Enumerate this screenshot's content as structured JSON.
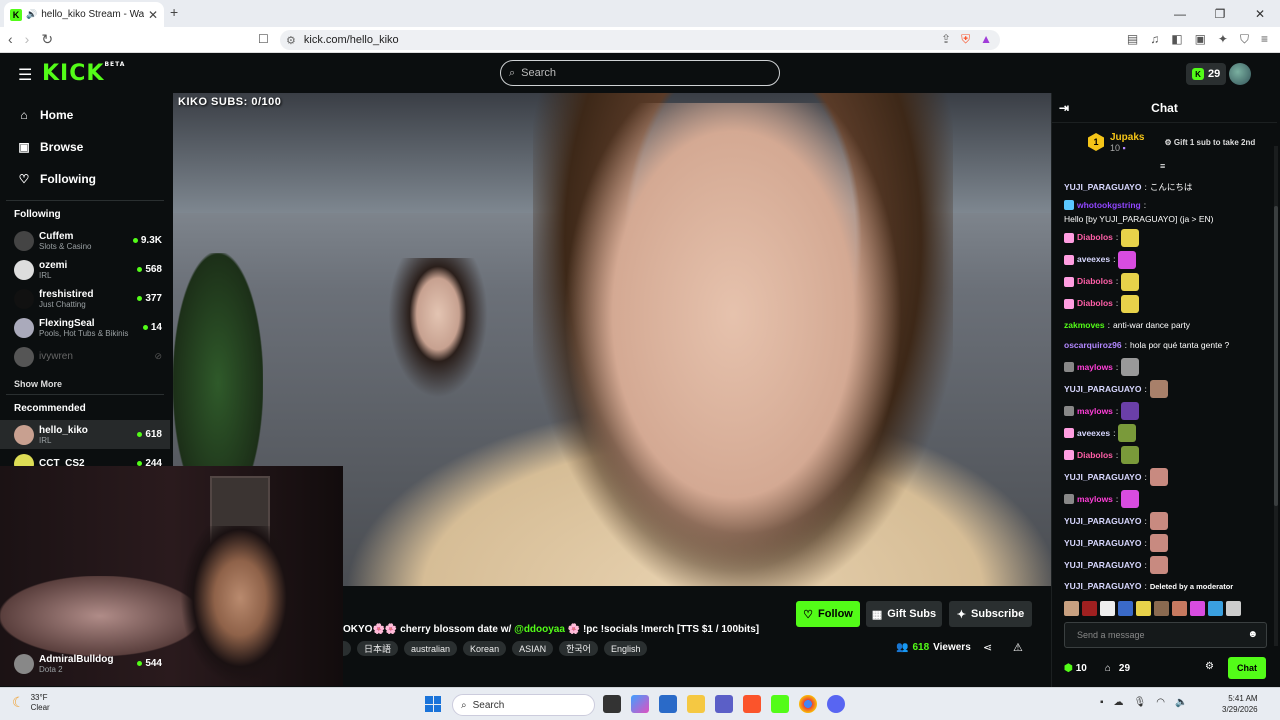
{
  "browser": {
    "tab_title": "hello_kiko Stream - Watch Li",
    "url": "kick.com/hello_kiko"
  },
  "topnav": {
    "logo": "KICK",
    "logo_badge": "BETA",
    "search_placeholder": "Search",
    "points": "29"
  },
  "sidebar": {
    "nav": [
      {
        "label": "Home"
      },
      {
        "label": "Browse"
      },
      {
        "label": "Following"
      }
    ],
    "following_label": "Following",
    "following": [
      {
        "name": "Cuffem",
        "category": "Slots & Casino",
        "viewers": "9.3K"
      },
      {
        "name": "ozemi",
        "category": "IRL",
        "viewers": "568"
      },
      {
        "name": "freshistired",
        "category": "Just Chatting",
        "viewers": "377"
      },
      {
        "name": "FlexingSeal",
        "category": "Pools, Hot Tubs & Bikinis",
        "viewers": "14"
      },
      {
        "name": "ivywren",
        "category": "",
        "viewers": ""
      }
    ],
    "show_more": "Show More",
    "recommended_label": "Recommended",
    "recommended": [
      {
        "name": "hello_kiko",
        "category": "IRL",
        "viewers": "618"
      },
      {
        "name": "CCT_CS2",
        "category": "",
        "viewers": "244"
      }
    ],
    "bottom_channel": {
      "name": "AdmiralBulldog",
      "category": "Dota 2",
      "viewers": "544"
    }
  },
  "video": {
    "overlay_text": "KIKO SUBS: 0/100"
  },
  "stream": {
    "title_prefix": "OKYO🌸🌸 cherry blossom date w/ ",
    "title_mention": "@ddooyaa",
    "title_suffix": " 🌸 !pc !socials !merch [TTS $1 / 100bits]",
    "tags": [
      "日本語",
      "australian",
      "Korean",
      "ASIAN",
      "한국어",
      "English"
    ],
    "follow_label": "Follow",
    "gift_label": "Gift Subs",
    "subscribe_label": "Subscribe",
    "viewers": "618",
    "viewers_label": "Viewers"
  },
  "chat": {
    "title": "Chat",
    "top_gifter": {
      "rank": "1",
      "name": "Jupaks",
      "count": "10",
      "cta": "Gift 1 sub to take 2nd"
    },
    "messages": [
      {
        "user": "YUJI_PARAGUAYO",
        "color": "#d8d8ff",
        "text": "こんにちは",
        "badge": ""
      },
      {
        "user": "whotookgstring",
        "color": "#9146ff",
        "text": "Hello [by YUJI_PARAGUAYO] (ja > EN)",
        "badge": "#5bc8ff"
      },
      {
        "user": "Diabolos",
        "color": "#ff5fa8",
        "text": "",
        "badge": "#ff9de0",
        "emote": "#e8d24a"
      },
      {
        "user": "aveexes",
        "color": "#d8d8ff",
        "text": "",
        "badge": "#ff9de0",
        "emote": "#d84ce0"
      },
      {
        "user": "Diabolos",
        "color": "#ff5fa8",
        "text": "",
        "badge": "#ff9de0",
        "emote": "#e8d24a"
      },
      {
        "user": "Diabolos",
        "color": "#ff5fa8",
        "text": "",
        "badge": "#ff9de0",
        "emote": "#e8d24a"
      },
      {
        "user": "zakmoves",
        "color": "#53fc18",
        "text": "anti-war dance party",
        "badge": ""
      },
      {
        "user": "oscarquiroz96",
        "color": "#b388ff",
        "text": "hola por qué tanta gente ?",
        "badge": ""
      },
      {
        "user": "maylows",
        "color": "#ff3fd8",
        "text": "",
        "badge": "#888",
        "emote": "#999"
      },
      {
        "user": "YUJI_PARAGUAYO",
        "color": "#d8d8ff",
        "text": "",
        "badge": "",
        "emote": "#a8806a"
      },
      {
        "user": "maylows",
        "color": "#ff3fd8",
        "text": "",
        "badge": "#888",
        "emote": "#6a3fa8"
      },
      {
        "user": "aveexes",
        "color": "#d8d8ff",
        "text": "",
        "badge": "#ff9de0",
        "emote": "#7a9a3a"
      },
      {
        "user": "Diabolos",
        "color": "#ff5fa8",
        "text": "",
        "badge": "#ff9de0",
        "emote": "#7a9a3a"
      },
      {
        "user": "YUJI_PARAGUAYO",
        "color": "#d8d8ff",
        "text": "",
        "badge": "",
        "emote": "#c88a80"
      },
      {
        "user": "maylows",
        "color": "#ff3fd8",
        "text": "",
        "badge": "#888",
        "emote": "#d84ce0"
      },
      {
        "user": "YUJI_PARAGUAYO",
        "color": "#d8d8ff",
        "text": "",
        "badge": "",
        "emote": "#c88a80"
      },
      {
        "user": "YUJI_PARAGUAYO",
        "color": "#d8d8ff",
        "text": "",
        "badge": "",
        "emote": "#c88a80"
      },
      {
        "user": "YUJI_PARAGUAYO",
        "color": "#d8d8ff",
        "text": "",
        "badge": "",
        "emote": "#c88a80"
      },
      {
        "user": "YUJI_PARAGUAYO",
        "color": "#d8d8ff",
        "text": "Deleted by a moderator",
        "badge": ""
      }
    ],
    "input_placeholder": "Send a message",
    "points": "10",
    "store_count": "29",
    "send_label": "Chat"
  },
  "taskbar": {
    "temp": "33°F",
    "condition": "Clear",
    "search_placeholder": "Search",
    "time": "5:41 AM",
    "date": "3/29/2026"
  },
  "colors": {
    "accent": "#53fc18",
    "background": "#0b0e0f",
    "panel": "#2a2f30"
  }
}
